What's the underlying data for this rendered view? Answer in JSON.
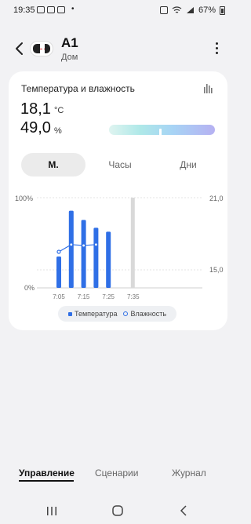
{
  "status_bar": {
    "time": "19:35",
    "dot": "•",
    "battery": "67%"
  },
  "header": {
    "device_name": "A1",
    "room": "Дом"
  },
  "card": {
    "title": "Температура и влажность",
    "temperature": "18,1",
    "temperature_unit": "°C",
    "humidity": "49,0",
    "humidity_unit": "%"
  },
  "tabs": [
    {
      "label": "М.",
      "active": true
    },
    {
      "label": "Часы",
      "active": false
    },
    {
      "label": "Дни",
      "active": false
    }
  ],
  "chart_data": {
    "type": "bar",
    "categories": [
      "7:05",
      "7:10",
      "7:15",
      "7:20",
      "7:25",
      "7:30",
      "7:35"
    ],
    "x_tick_labels": [
      "7:05",
      "7:15",
      "7:25",
      "7:35"
    ],
    "series": [
      {
        "name": "Температура",
        "type": "bar",
        "axis": "right",
        "color": "#2f6fe6",
        "values": [
          16.5,
          20.0,
          19.3,
          18.7,
          18.4,
          null,
          null
        ]
      },
      {
        "name": "Влажность",
        "type": "line",
        "axis": "left",
        "color": "#2f6fe6",
        "values": [
          40,
          48,
          47,
          48,
          null,
          null,
          null
        ]
      }
    ],
    "left_axis": {
      "ticks": [
        "100%",
        "0%"
      ],
      "range": [
        0,
        100
      ]
    },
    "right_axis": {
      "ticks": [
        "21,0",
        "15,0"
      ],
      "range": [
        15.0,
        21.0
      ]
    },
    "current_marker": "7:35",
    "grid": true,
    "legend_position": "bottom"
  },
  "bottom_tabs": [
    {
      "label": "Управление",
      "active": true
    },
    {
      "label": "Сценарии",
      "active": false
    },
    {
      "label": "Журнал",
      "active": false
    }
  ]
}
